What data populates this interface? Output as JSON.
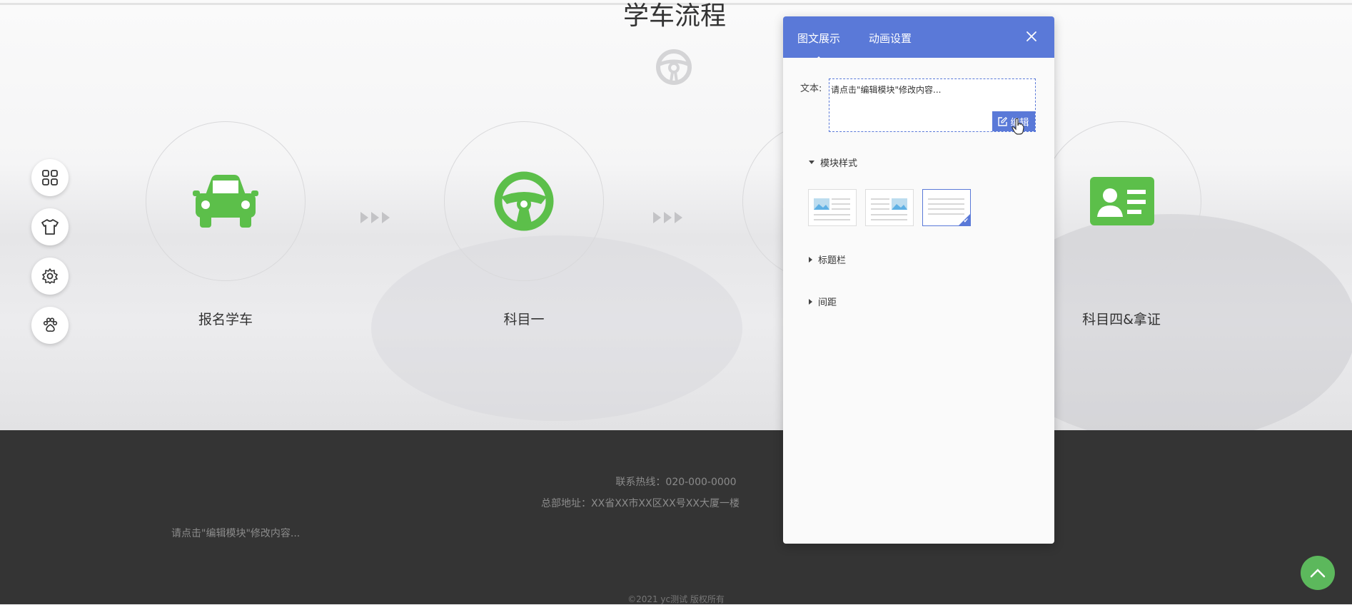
{
  "section": {
    "title": "学车流程"
  },
  "steps": [
    {
      "label": "报名学车",
      "icon": "car-icon"
    },
    {
      "label": "科目一",
      "icon": "steering-wheel-icon"
    },
    {
      "label": "",
      "icon": "hidden-step-icon"
    },
    {
      "label": "科目四&拿证",
      "icon": "id-card-icon"
    }
  ],
  "toolbar": {
    "items": [
      "grid-icon",
      "shirt-icon",
      "gear-icon",
      "paw-icon"
    ]
  },
  "footer": {
    "hotline": "联系热线：020-000-0000",
    "address": "总部地址：XX省XX市XX区XX号XX大厦一楼",
    "edit_hint": "请点击\"编辑模块\"修改内容...",
    "copyright": "©2021 yc测试 版权所有"
  },
  "panel": {
    "tabs": [
      {
        "label": "图文展示",
        "active": true
      },
      {
        "label": "动画设置",
        "active": false
      }
    ],
    "text_label": "文本:",
    "text_value": "请点击\"编辑模块\"修改内容...",
    "edit_button": "编辑",
    "sections": {
      "module_style": "模块样式",
      "title_bar": "标题栏",
      "spacing": "间距"
    },
    "style_options": [
      "image-left",
      "image-right",
      "text-only"
    ],
    "selected_style": 2
  },
  "colors": {
    "accent": "#5a79d8",
    "icon_green": "#5cbf4a",
    "footer_bg": "#343434"
  }
}
